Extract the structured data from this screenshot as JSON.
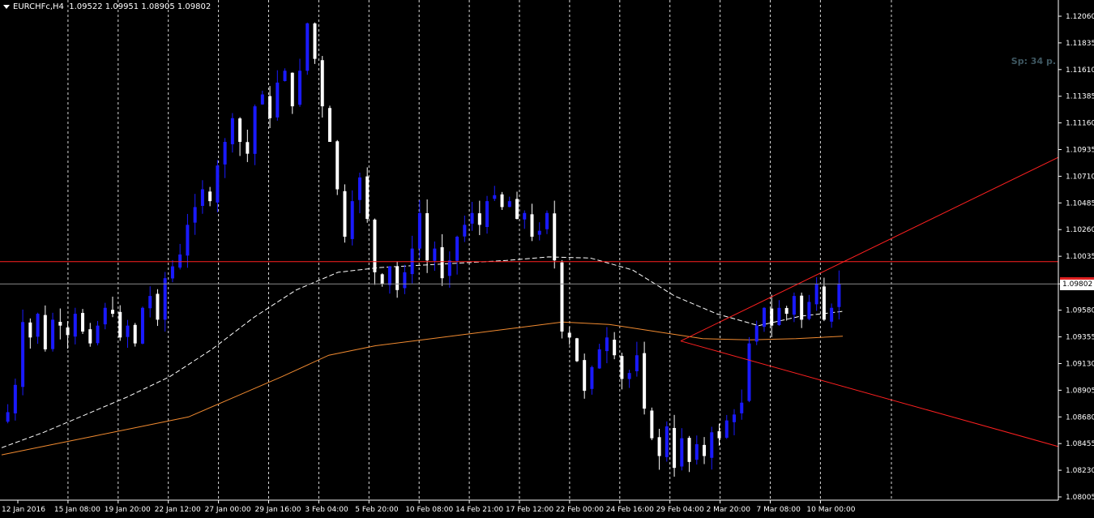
{
  "header": {
    "symbol_label": "EURCHFc,H4",
    "ohlc": "1.09522 1.09951 1.08905 1.09802"
  },
  "spread_label": "Sp: 34 p.",
  "current_price": "1.09802",
  "colors": {
    "background": "#000000",
    "grid": "#ffffff",
    "bull": "#1a1aff",
    "bear": "#ffffff",
    "ma_fast": "#ffffff",
    "ma_slow": "#f08a30",
    "lines": "#ff2020",
    "axis_text": "#ffffff"
  },
  "chart_data": {
    "type": "candlestick",
    "y_ticks": [
      "1.12060",
      "1.11835",
      "1.11610",
      "1.11385",
      "1.11160",
      "1.10935",
      "1.10710",
      "1.10485",
      "1.10260",
      "1.10035",
      "1.09802",
      "1.09580",
      "1.09355",
      "1.09130",
      "1.08905",
      "1.08680",
      "1.08455",
      "1.08230",
      "1.08005"
    ],
    "ylim": [
      1.08005,
      1.1206
    ],
    "x_labels": [
      "12 Jan 2016",
      "15 Jan 08:00",
      "19 Jan 20:00",
      "22 Jan 12:00",
      "27 Jan 00:00",
      "29 Jan 16:00",
      "3 Feb 04:00",
      "5 Feb 20:00",
      "10 Feb 08:00",
      "14 Feb 21:00",
      "17 Feb 12:00",
      "22 Feb 00:00",
      "24 Feb 16:00",
      "29 Feb 04:00",
      "2 Mar 20:00",
      "7 Mar 08:00",
      "10 Mar 00:00"
    ],
    "vertical_grid_count": 17,
    "horizontal_line": 1.0999,
    "bid_line": 1.09802,
    "close_path": [
      1.0872,
      1.0895,
      1.0948,
      1.0935,
      1.0955,
      1.0925,
      1.095,
      1.0945,
      1.0937,
      1.0955,
      1.094,
      1.093,
      1.0945,
      1.096,
      1.0955,
      1.0935,
      1.0945,
      1.093,
      1.096,
      1.097,
      1.095,
      1.0985,
      1.0995,
      1.1005,
      1.103,
      1.1045,
      1.106,
      1.105,
      1.108,
      1.11,
      1.112,
      1.11,
      1.109,
      1.113,
      1.114,
      1.112,
      1.115,
      1.116,
      1.113,
      1.116,
      1.12,
      1.117,
      1.113,
      1.11,
      1.106,
      1.102,
      1.105,
      1.107,
      1.1035,
      1.099,
      1.098,
      1.0995,
      1.0975,
      1.099,
      1.101,
      1.104,
      1.1,
      1.101,
      1.0985,
      1.1,
      1.102,
      1.103,
      1.104,
      1.103,
      1.105,
      1.1055,
      1.1045,
      1.105,
      1.1035,
      1.104,
      1.102,
      1.1025,
      1.104,
      1.1,
      1.094,
      1.0935,
      1.0915,
      1.089,
      1.091,
      1.0925,
      1.0935,
      1.092,
      1.09,
      1.0905,
      1.092,
      1.0875,
      1.085,
      1.0835,
      1.086,
      1.0825,
      1.085,
      1.083,
      1.0845,
      1.0835,
      1.0855,
      1.085,
      1.0865,
      1.087,
      1.088,
      1.093,
      1.0945,
      1.096,
      1.0945,
      1.096,
      1.0955,
      1.097,
      1.095,
      1.0965,
      1.098,
      1.095,
      1.096,
      1.098
    ],
    "ma_fast": [
      1.0842,
      1.0855,
      1.087,
      1.0885,
      1.0902,
      1.0925,
      1.0952,
      1.0975,
      1.099,
      1.0994,
      1.0996,
      1.0998,
      1.1,
      1.1003,
      1.1002,
      1.0992,
      1.097,
      1.0955,
      1.0945,
      1.0953,
      1.0957
    ],
    "ma_slow": [
      1.0836,
      1.0844,
      1.0852,
      1.086,
      1.0868,
      1.0885,
      1.0902,
      1.092,
      1.0928,
      1.0933,
      1.0938,
      1.0943,
      1.0948,
      1.0946,
      1.094,
      1.0934,
      1.0933,
      1.0934,
      1.0936
    ],
    "trend_lines": [
      {
        "from": [
          "28 Feb",
          1.0932
        ],
        "to": [
          "13 Mar",
          1.1087
        ]
      },
      {
        "from": [
          "28 Feb",
          1.0932
        ],
        "to": [
          "13 Mar",
          1.0843
        ]
      }
    ],
    "grid": "dashed vertical"
  }
}
